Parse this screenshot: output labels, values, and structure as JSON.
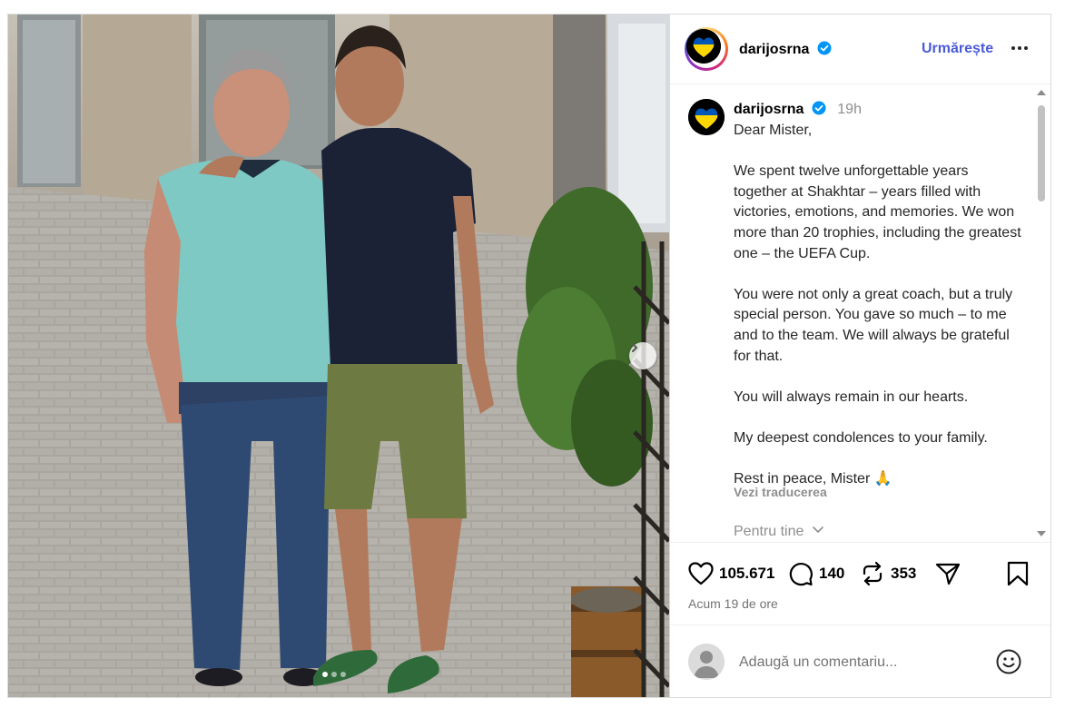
{
  "post": {
    "username": "darijosrna",
    "follow_label": "Urmărește",
    "time_short": "19h",
    "caption": "Dear Mister,\n\nWe spent twelve unforgettable years together at Shakhtar – years filled with victories, emotions, and memories. We won more than 20 trophies, including the greatest one – the UEFA Cup.\n\nYou were not only a great coach, but a truly special person. You gave so much – to me and to the team. We will always be grateful for that.\n\nYou will always remain in our hearts.\n\nMy deepest condolences to your family.\n\nRest in peace, Mister 🙏",
    "translate_label": "Vezi traducerea",
    "for_you_label": "Pentru tine",
    "likes": "105.671",
    "comments_count": "140",
    "reposts": "353",
    "posted_ago": "Acum 19 de ore",
    "comment_placeholder": "Adaugă un comentariu...",
    "carousel": {
      "slides": 3,
      "active_index": 0
    }
  },
  "colors": {
    "follow_blue": "#4a5bd6",
    "verified_blue": "#0095f6",
    "ukraine_blue": "#0057b7",
    "ukraine_yellow": "#ffd700"
  },
  "icons": [
    "more-options-icon",
    "verified-badge-icon",
    "heart-icon",
    "comment-icon",
    "repost-icon",
    "share-icon",
    "bookmark-icon",
    "emoji-icon",
    "chevron-right-icon",
    "chevron-down-icon"
  ]
}
